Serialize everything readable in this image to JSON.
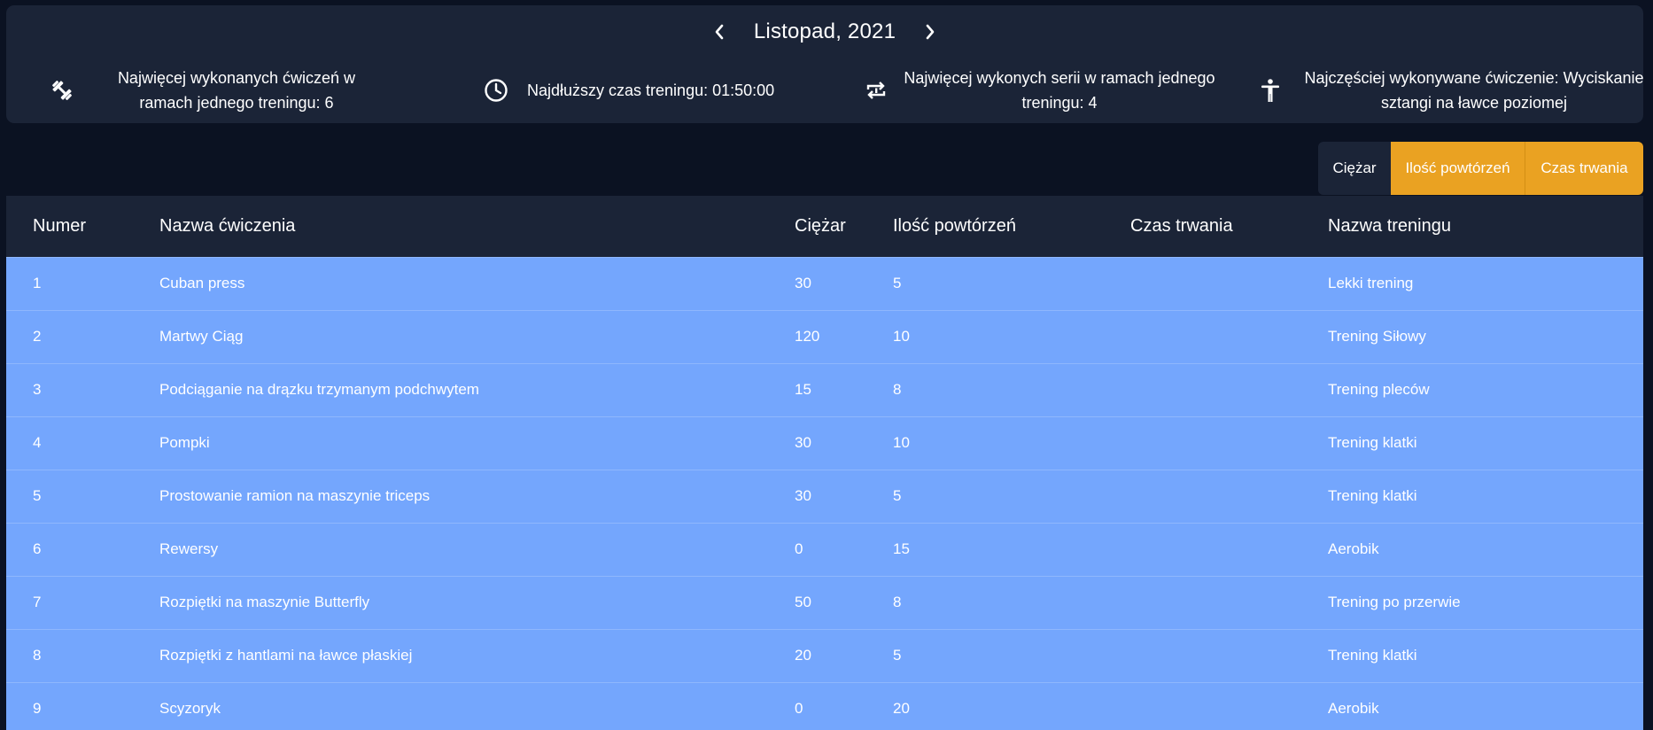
{
  "header": {
    "month_title": "Listopad, 2021",
    "prev_icon": "chevron-left-icon",
    "next_icon": "chevron-right-icon"
  },
  "stats": {
    "most_exercises": "Najwięcej wykonanych ćwiczeń w ramach jednego treningu: 6",
    "longest_time": "Najdłuższy czas treningu: 01:50:00",
    "most_series": "Najwięcej wykonych serii w ramach jednego treningu: 4",
    "most_frequent": "Najczęściej wykonywane ćwiczenie: Wyciskanie sztangi na ławce poziomej"
  },
  "icons": {
    "most_exercises": "dumbbell-icon",
    "longest_time": "clock-icon",
    "most_series": "repeat-icon",
    "most_frequent": "person-icon"
  },
  "toggles": {
    "weight": "Ciężar",
    "reps": "Ilość powtórzeń",
    "duration": "Czas trwania"
  },
  "colors": {
    "background": "#0b1222",
    "panel": "#1b2437",
    "row": "#74a6fd",
    "accent": "#eaa222"
  },
  "table": {
    "headers": {
      "number": "Numer",
      "name": "Nazwa ćwiczenia",
      "weight": "Ciężar",
      "reps": "Ilość powtórzeń",
      "duration": "Czas trwania",
      "training": "Nazwa treningu"
    },
    "rows": [
      {
        "number": "1",
        "name": "Cuban press",
        "weight": "30",
        "reps": "5",
        "duration": "",
        "training": "Lekki trening"
      },
      {
        "number": "2",
        "name": "Martwy Ciąg",
        "weight": "120",
        "reps": "10",
        "duration": "",
        "training": "Trening Siłowy"
      },
      {
        "number": "3",
        "name": "Podciąganie na drązku trzymanym podchwytem",
        "weight": "15",
        "reps": "8",
        "duration": "",
        "training": "Trening pleców"
      },
      {
        "number": "4",
        "name": "Pompki",
        "weight": "30",
        "reps": "10",
        "duration": "",
        "training": "Trening klatki"
      },
      {
        "number": "5",
        "name": "Prostowanie ramion na maszynie triceps",
        "weight": "30",
        "reps": "5",
        "duration": "",
        "training": "Trening klatki"
      },
      {
        "number": "6",
        "name": "Rewersy",
        "weight": "0",
        "reps": "15",
        "duration": "",
        "training": "Aerobik"
      },
      {
        "number": "7",
        "name": "Rozpiętki na maszynie Butterfly",
        "weight": "50",
        "reps": "8",
        "duration": "",
        "training": "Trening po przerwie"
      },
      {
        "number": "8",
        "name": "Rozpiętki z hantlami na ławce płaskiej",
        "weight": "20",
        "reps": "5",
        "duration": "",
        "training": "Trening klatki"
      },
      {
        "number": "9",
        "name": "Scyzoryk",
        "weight": "0",
        "reps": "20",
        "duration": "",
        "training": "Aerobik"
      }
    ]
  }
}
